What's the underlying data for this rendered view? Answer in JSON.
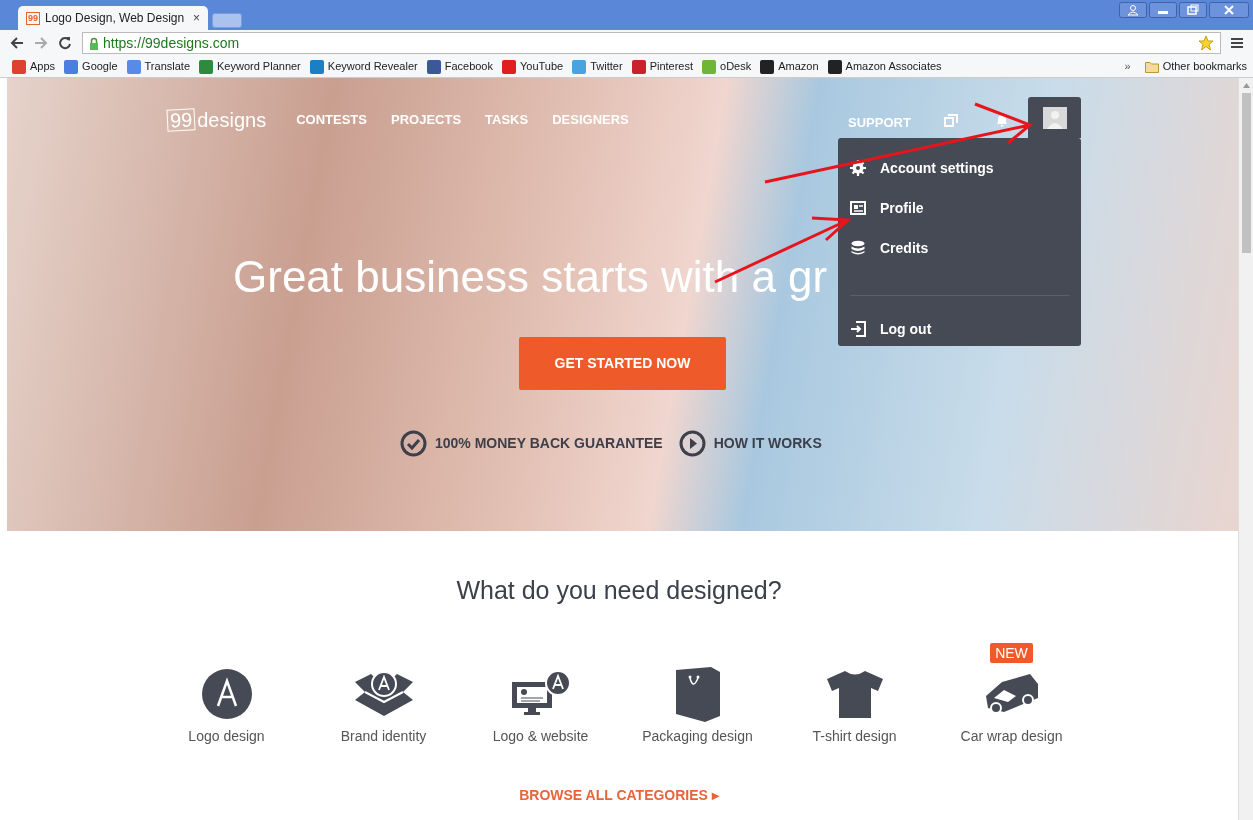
{
  "browser": {
    "tab": {
      "favicon_text": "99",
      "title": "Logo Design, Web Design",
      "close": "×"
    },
    "address": "https://99designs.com",
    "bookmarks": [
      {
        "label": "Apps",
        "color": "#e04030"
      },
      {
        "label": "Google",
        "color": "#4a7fe0"
      },
      {
        "label": "Translate",
        "color": "#5a8ae8"
      },
      {
        "label": "Keyword Planner",
        "color": "#2d8a3e"
      },
      {
        "label": "Keyword Revealer",
        "color": "#1b7fc4"
      },
      {
        "label": "Facebook",
        "color": "#3b5998"
      },
      {
        "label": "YouTube",
        "color": "#e02020"
      },
      {
        "label": "Twitter",
        "color": "#4aa3df"
      },
      {
        "label": "Pinterest",
        "color": "#c8232c"
      },
      {
        "label": "oDesk",
        "color": "#6fb536"
      },
      {
        "label": "Amazon",
        "color": "#222222"
      },
      {
        "label": "Amazon Associates",
        "color": "#222222"
      }
    ],
    "overflow": "»",
    "other_bookmarks": "Other bookmarks"
  },
  "site": {
    "logo": {
      "badge": "99",
      "text": "designs"
    },
    "nav": [
      "CONTESTS",
      "PROJECTS",
      "TASKS",
      "DESIGNERS"
    ],
    "support": "SUPPORT",
    "menu": [
      {
        "kind": "gear",
        "label": "Account settings"
      },
      {
        "kind": "card",
        "label": "Profile"
      },
      {
        "kind": "coins",
        "label": "Credits"
      },
      {
        "kind": "divider"
      },
      {
        "kind": "logout",
        "label": "Log out"
      }
    ],
    "hero": {
      "headline": "Great business starts with a gr",
      "cta": "GET STARTED NOW",
      "links": [
        {
          "kind": "check",
          "label": "100% MONEY BACK GUARANTEE"
        },
        {
          "kind": "play",
          "label": "HOW IT WORKS"
        }
      ]
    },
    "section_title": "What do you need designed?",
    "categories": [
      {
        "kind": "logo",
        "label": "Logo design"
      },
      {
        "kind": "brand",
        "label": "Brand identity"
      },
      {
        "kind": "web",
        "label": "Logo & website"
      },
      {
        "kind": "bag",
        "label": "Packaging design"
      },
      {
        "kind": "shirt",
        "label": "T-shirt design"
      },
      {
        "kind": "car",
        "label": "Car wrap design",
        "badge": "NEW"
      }
    ],
    "browse": "BROWSE ALL CATEGORIES ▸"
  }
}
